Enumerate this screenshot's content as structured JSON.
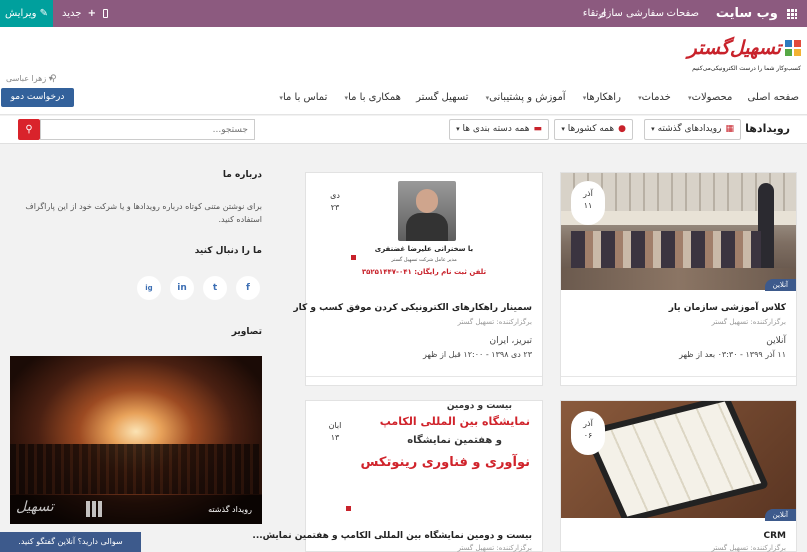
{
  "topbar": {
    "brand": "وب سایت",
    "menu": [
      "صفحات",
      "سفارشی سازی",
      "ارتقاء"
    ],
    "new_label": "جدید",
    "edit_label": "ویرایش",
    "bg": "#8c5a7f",
    "edit_bg": "#00a09d"
  },
  "header": {
    "logo_text": "تسهیل‌گستر",
    "logo_tagline": "کسب‌وکار شما را درست الکترونیکی‌می‌کنیم",
    "user_name": "زهرا عباسی",
    "nav": [
      {
        "label": "صفحه اصلی",
        "caret": false
      },
      {
        "label": "محصولات",
        "caret": true
      },
      {
        "label": "خدمات",
        "caret": true
      },
      {
        "label": "راهکارها",
        "caret": true
      },
      {
        "label": "آموزش و پشتیبانی",
        "caret": true
      },
      {
        "label": "تسهیل گستر",
        "caret": false
      },
      {
        "label": "همکاری با ما",
        "caret": true
      },
      {
        "label": "تماس با ما",
        "caret": true
      }
    ],
    "demo_button": "درخواست دمو"
  },
  "toolbar": {
    "title": "رویدادها",
    "filter_time": "رویدادهای گذشته",
    "filter_country": "همه کشورها",
    "filter_category": "همه دسته بندی ها",
    "search_placeholder": "جستجو..."
  },
  "events": [
    {
      "day": "آذر",
      "num": "۱۱",
      "badge": "آنلاین",
      "title": "کلاس آموزشی سازمان یار",
      "org": "برگزارکننده: تسهیل گستر",
      "loc": "آنلاین",
      "time": "۱۱ آذر ۱۳۹۹ - ۰۳:۳۰ بعد از ظهر"
    },
    {
      "day": "دی",
      "num": "۲۳",
      "title": "سمینار راهکارهای الکترونیکی کردن موفق کسب و کار",
      "org": "برگزارکننده: تسهیل گستر",
      "loc": "تبریز، ایران",
      "time": "۲۳ دی ۱۳۹۸ - ۱۲:۰۰ قبل از ظهر",
      "speaker": "با سخنرانی علیرضا غضنفری",
      "speaker_role": "مدیر عامل شرکت تسهیل گستر",
      "phone_note": "تلفن ثبت نام رایگان: ۰۴۱-۳۵۲۵۱۴۴۷"
    },
    {
      "day": "آذر",
      "num": "۰۶",
      "badge": "آنلاین",
      "title": "CRM",
      "org": "برگزارکننده: تسهیل گستر"
    },
    {
      "day": "ابان",
      "num": "۱۳",
      "title": "بیست و دومین نمایشگاه بین المللی الکامپ و هفتمین نمایش...",
      "org": "برگزارکننده: تسهیل گستر",
      "poster_l1": "بیست و دومین",
      "poster_l2": "نمایشگاه بین المللی الکامپ",
      "poster_l3": "و هفتمین نمایشگاه",
      "poster_l4": "نوآوری و فناوری رینوتکس"
    }
  ],
  "sidebar": {
    "about_title": "درباره ما",
    "about_text": "برای نوشتن متنی کوتاه درباره رویدادها و یا شرکت خود از این پاراگراف استفاده کنید.",
    "follow_title": "ما را دنبال کنید",
    "social": [
      "f",
      "t",
      "in",
      "ig"
    ],
    "photos_title": "تصاویر",
    "photo_caption": "رویداد گذشته"
  },
  "chat_label": "سوالی دارید؟ آنلاین گفتگو کنید."
}
